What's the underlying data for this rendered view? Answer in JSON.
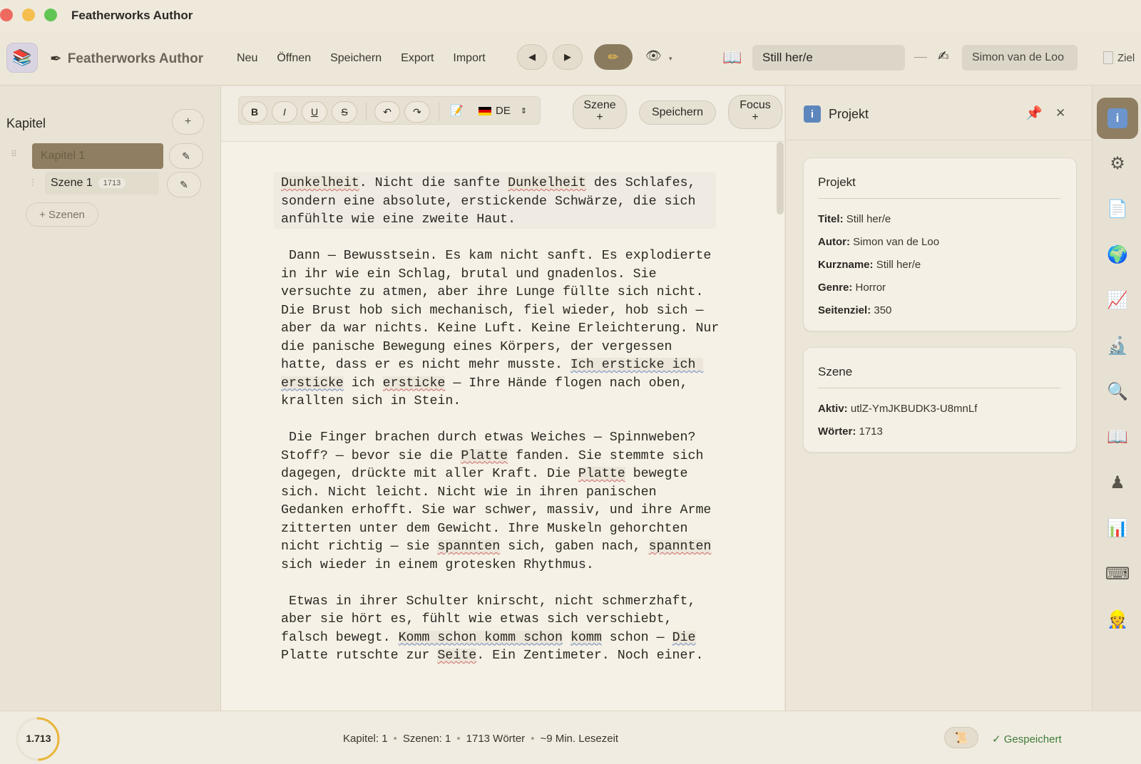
{
  "window": {
    "title": "Featherworks Author"
  },
  "toolbar": {
    "brand": "Featherworks Author",
    "menu": [
      "Neu",
      "Öffnen",
      "Speichern",
      "Export",
      "Import"
    ],
    "project_title": "Still her/e",
    "author": "Simon van de Loo",
    "goal_label": "Ziel"
  },
  "sidebar": {
    "title": "Kapitel",
    "add_label": "+",
    "chapters": [
      {
        "label": "Kapitel 1"
      }
    ],
    "scenes": [
      {
        "label": "Szene 1",
        "words": "1713"
      }
    ],
    "add_scenes_label": "+ Szenen"
  },
  "editor_toolbar": {
    "bold": "B",
    "italic": "I",
    "underline": "U",
    "strike": "S",
    "language": "DE",
    "scene_button": {
      "line1": "Szene",
      "line2": "+"
    },
    "save_button": "Speichern",
    "focus_button": {
      "line1": "Focus",
      "line2": "+"
    }
  },
  "editor": {
    "paragraphs": [
      [
        {
          "t": "Dunkelheit",
          "s": "red"
        },
        {
          "t": ". Nicht die sanfte "
        },
        {
          "t": "Dunkelheit",
          "s": "red"
        },
        {
          "t": " des Schlafes, sondern eine absolute, erstickende Schwärze, die sich anfühlte wie eine zweite Haut."
        }
      ],
      [
        {
          "t": " Dann — Bewusstsein. Es kam nicht sanft. Es explodierte in ihr wie ein Schlag, brutal und gnadenlos. Sie versuchte zu atmen, aber ihre Lunge füllte sich nicht. Die Brust hob sich mechanisch, fiel wieder, hob sich — aber da war nichts. Keine Luft. Keine Erleichterung. Nur die panische Bewegung eines Körpers, der vergessen hatte, dass er es nicht mehr musste. "
        },
        {
          "t": "Ich ersticke ich ersticke",
          "s": "blue"
        },
        {
          "t": " ich "
        },
        {
          "t": "ersticke",
          "s": "red"
        },
        {
          "t": " — Ihre Hände flogen nach oben, krallten sich in Stein."
        }
      ],
      [
        {
          "t": " Die Finger brachen durch etwas Weiches — Spinnweben? Stoff? — bevor sie die "
        },
        {
          "t": "Platte",
          "s": "red"
        },
        {
          "t": " fanden. Sie stemmte sich dagegen, drückte mit aller Kraft. Die "
        },
        {
          "t": "Platte",
          "s": "red"
        },
        {
          "t": " bewegte sich. Nicht leicht. Nicht wie in ihren panischen Gedanken erhofft. Sie war schwer, massiv, und ihre Arme zitterten unter dem Gewicht. Ihre Muskeln gehorchten nicht richtig — sie "
        },
        {
          "t": "spannten",
          "s": "red"
        },
        {
          "t": " sich, gaben nach, "
        },
        {
          "t": "spannten",
          "s": "red"
        },
        {
          "t": " sich wieder in einem grotesken Rhythmus."
        }
      ],
      [
        {
          "t": " Etwas in ihrer Schulter knirscht, nicht schmerzhaft, aber sie hört es, fühlt wie etwas sich verschiebt, falsch bewegt. "
        },
        {
          "t": "Komm schon komm schon",
          "s": "blue"
        },
        {
          "t": " "
        },
        {
          "t": "komm",
          "s": "blue"
        },
        {
          "t": " schon — "
        },
        {
          "t": "Die",
          "s": "blue"
        },
        {
          "t": " Platte rutschte zur "
        },
        {
          "t": "Seite",
          "s": "red"
        },
        {
          "t": ". Ein Zentimeter. Noch einer."
        }
      ]
    ]
  },
  "panel": {
    "title": "Projekt",
    "project_card": {
      "title": "Projekt",
      "rows": [
        {
          "k": "Titel:",
          "v": "Still her/e"
        },
        {
          "k": "Autor:",
          "v": "Simon van de Loo"
        },
        {
          "k": "Kurzname:",
          "v": "Still her/e"
        },
        {
          "k": "Genre:",
          "v": "Horror"
        },
        {
          "k": "Seitenziel:",
          "v": "350"
        }
      ]
    },
    "scene_card": {
      "title": "Szene",
      "rows": [
        {
          "k": "Aktiv:",
          "v": "utlZ-YmJKBUDK3-U8mnLf"
        },
        {
          "k": "Wörter:",
          "v": "1713"
        }
      ]
    }
  },
  "rail_icons": [
    "info-icon",
    "gear-icon",
    "document-icon",
    "globe-icon",
    "line-chart-icon",
    "microscope-icon",
    "search-icon",
    "open-book-icon",
    "character-icon",
    "bar-chart-icon",
    "keyboard-icon",
    "avatar-icon"
  ],
  "status": {
    "word_count": "1.713",
    "goal_progress": 0.49,
    "chapters": "Kapitel: 1",
    "scenes": "Szenen: 1",
    "words": "1713 Wörter",
    "reading_time": "~9 Min. Lesezeit",
    "saved": "✓ Gespeichert"
  },
  "colors": {
    "accent": "#8f7e61",
    "progress": "#e8b53a",
    "saved": "#3e7d3a",
    "spell_red": "#d16a6a",
    "grammar_blue": "#6a8fc8"
  }
}
